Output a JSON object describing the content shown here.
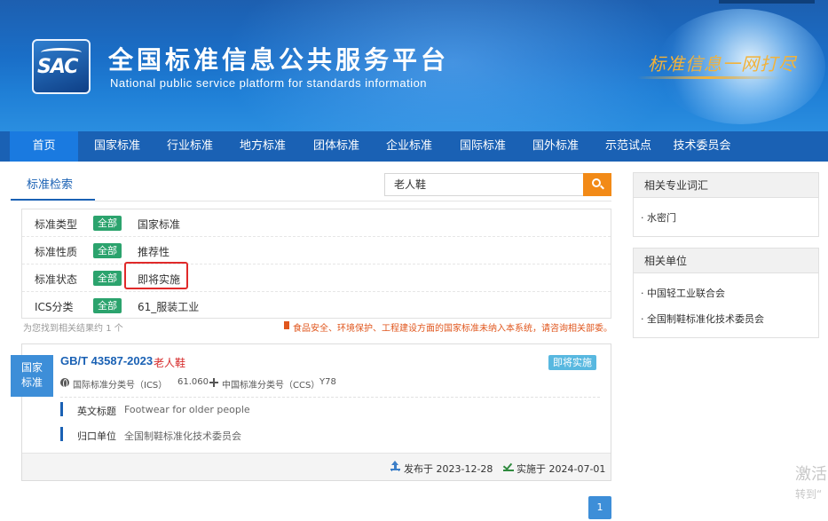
{
  "header": {
    "logo_text": "SAC",
    "title_cn": "全国标准信息公共服务平台",
    "title_en": "National public service platform  for standards information",
    "slogan": "标准信息一网打尽"
  },
  "nav": {
    "items": [
      {
        "label": "首页"
      },
      {
        "label": "国家标准"
      },
      {
        "label": "行业标准"
      },
      {
        "label": "地方标准"
      },
      {
        "label": "团体标准"
      },
      {
        "label": "企业标准"
      },
      {
        "label": "国际标准"
      },
      {
        "label": "国外标准"
      },
      {
        "label": "示范试点"
      },
      {
        "label": "技术委员会"
      }
    ]
  },
  "search": {
    "tab_label": "标准检索",
    "query": "老人鞋",
    "button_icon": "search-icon"
  },
  "filters": [
    {
      "label": "标准类型",
      "badge": "全部",
      "value": "国家标准"
    },
    {
      "label": "标准性质",
      "badge": "全部",
      "value": "推荐性"
    },
    {
      "label": "标准状态",
      "badge": "全部",
      "value": "即将实施"
    },
    {
      "label": "ICS分类",
      "badge": "全部",
      "value": "61_服装工业"
    }
  ],
  "results": {
    "count_prefix": "为您找到相关结果约",
    "count": "1",
    "count_suffix": "个",
    "notice": "食品安全、环境保护、工程建设方面的国家标准未纳入本系统，请咨询相关部委。"
  },
  "result_card": {
    "category_line1": "国家",
    "category_line2": "标准",
    "code": "GB/T 43587-2023",
    "name": "老人鞋",
    "status": "即将实施",
    "ics_label": "国际标准分类号（ICS）",
    "ics_value": "61.060",
    "ccs_label": "中国标准分类号（CCS）",
    "ccs_value": "Y78",
    "en_title_label": "英文标题",
    "en_title_value": "Footwear for older people",
    "owner_label": "归口单位",
    "owner_value": "全国制鞋标准化技术委员会",
    "published": "发布于 2023-12-28",
    "effective": "实施于 2024-07-01"
  },
  "pagination": {
    "current": "1"
  },
  "sidebar": {
    "terms_title": "相关专业词汇",
    "terms": [
      "· 水密门"
    ],
    "units_title": "相关单位",
    "units": [
      "· 中国轻工业联合会",
      "· 全国制鞋标准化技术委员会"
    ]
  },
  "watermark": {
    "line1": "激活",
    "line2": "转到“"
  },
  "colors": {
    "nav_bg": "#1a61b4",
    "nav_active": "#1a7ae0",
    "badge_green": "#2ba36d",
    "search_orange": "#f28a17",
    "status_blue": "#58b8e0",
    "highlight_red": "#e02a2a"
  }
}
